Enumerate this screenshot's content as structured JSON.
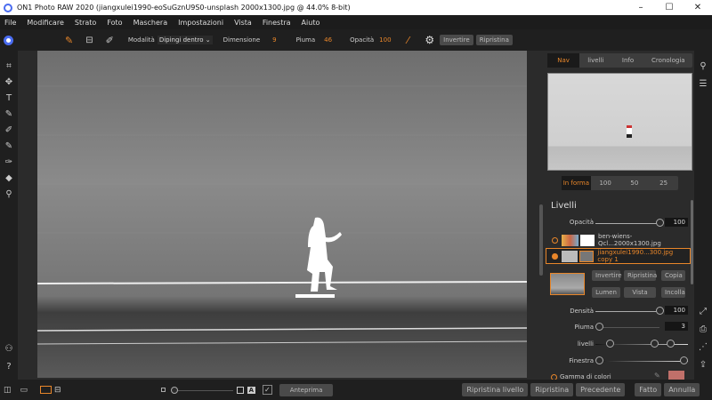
{
  "window": {
    "title": "ON1 Photo RAW 2020 (jiangxulei1990-eoSuGznU9S0-unsplash 2000x1300.jpg @ 44.0% 8-bit)",
    "minimize": "–",
    "maximize": "☐",
    "close": "✕"
  },
  "menu": [
    "File",
    "Modificare",
    "Strato",
    "Foto",
    "Maschera",
    "Impostazioni",
    "Vista",
    "Finestra",
    "Aiuto"
  ],
  "toolbar": {
    "mode_label": "Modalità",
    "mode_value": "Dipingi dentro",
    "size_label": "Dimensione",
    "size_value": "9",
    "feather_label": "Piuma",
    "feather_value": "46",
    "opacity_label": "Opacità",
    "opacity_value": "100",
    "invert": "Invertire",
    "reset": "Ripristina"
  },
  "nav": {
    "tabs": [
      "Nav",
      "livelli",
      "Info",
      "Cronologia"
    ],
    "zoom": [
      "In forma",
      "100",
      "50",
      "25"
    ]
  },
  "layers": {
    "title": "Livelli",
    "opacity_label": "Opacità",
    "opacity_value": "100",
    "items": [
      {
        "name": "ben-wiens-Qcl...2000x1300.jpg"
      },
      {
        "name": "jiangxulei1990...300.jpg copy 1"
      }
    ]
  },
  "mask": {
    "buttons": [
      "Invertire",
      "Ripristina",
      "Copia",
      "Lumen",
      "Vista",
      "Incolla"
    ],
    "density_label": "Densità",
    "density_value": "100",
    "feather_label": "Piuma",
    "feather_value": "3",
    "levels_label": "livelli",
    "window_label": "Finestra",
    "color_range_label": "Gamma di colori",
    "swatch_color": "#c0706a"
  },
  "bottom": {
    "preview": "Anteprima",
    "reset_layer": "Ripristina livello",
    "reset": "Ripristina",
    "previous": "Precedente",
    "done": "Fatto",
    "cancel": "Annulla"
  },
  "accent": "#e8862a"
}
